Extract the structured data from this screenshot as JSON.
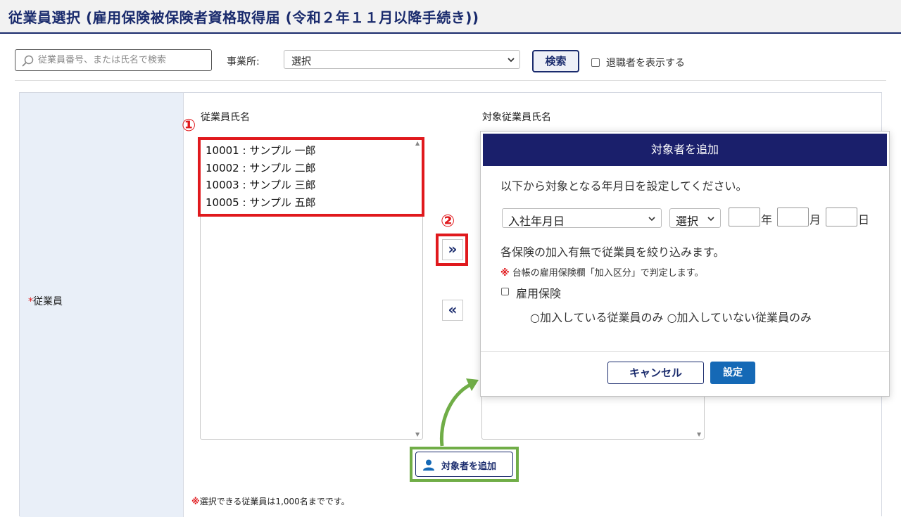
{
  "header": {
    "title": "従業員選択 (雇用保険被保険者資格取得届 (令和２年１１月以降手続き))"
  },
  "search": {
    "placeholder": "従業員番号、または氏名で検索",
    "office_label": "事業所:",
    "office_selected": "選択",
    "search_button": "検索",
    "show_retired_label": "退職者を表示する"
  },
  "form": {
    "required_mark": "*",
    "field_label": "従業員",
    "employee_list_header": "従業員氏名",
    "target_list_header": "対象従業員氏名",
    "employees": [
      "10001 : サンプル 一郎",
      "10002 : サンプル 二郎",
      "10003 : サンプル 三郎",
      "10005 : サンプル 五郎"
    ],
    "move_right": "»",
    "move_left": "«",
    "add_target_button": "対象者を追加",
    "note_mark": "※",
    "note": "選択できる従業員は1,000名までです。"
  },
  "annotations": {
    "step1": "①",
    "step2": "②"
  },
  "modal": {
    "title": "対象者を追加",
    "instruction": "以下から対象となる年月日を設定してください。",
    "date_type": "入社年月日",
    "era": "選択",
    "year_unit": "年",
    "month_unit": "月",
    "day_unit": "日",
    "filter_desc": "各保険の加入有無で従業員を絞り込みます。",
    "note_mark": "※",
    "note": " 台帳の雇用保険欄「加入区分」で判定します。",
    "insurance_label": "雇用保険",
    "radio_enrolled": "○加入している従業員のみ",
    "radio_not_enrolled": "○加入していない従業員のみ",
    "cancel_button": "キャンセル",
    "set_button": "設定"
  },
  "colors": {
    "navy": "#1a2b6d",
    "modal_header": "#1a1f6b",
    "primary": "#1569b6",
    "annotation_red": "#e0191d",
    "annotation_green": "#70ad47",
    "side_bg": "#e9eff8"
  },
  "icons": [
    "search-icon",
    "chevron-down-icon",
    "user-icon",
    "arrow-icon"
  ]
}
